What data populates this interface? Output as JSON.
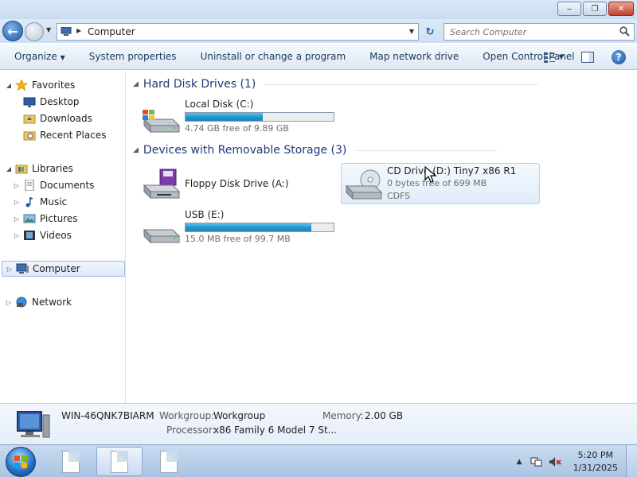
{
  "window": {
    "minimize": "‒",
    "maximize": "❐",
    "close": "✕"
  },
  "address": {
    "path": "Computer",
    "search_placeholder": "Search Computer"
  },
  "toolbar": {
    "organize": "Organize",
    "system_properties": "System properties",
    "uninstall": "Uninstall or change a program",
    "map_network_drive": "Map network drive",
    "open_control_panel": "Open Control Panel",
    "help": "?"
  },
  "nav": {
    "favorites": "Favorites",
    "desktop": "Desktop",
    "downloads": "Downloads",
    "recent_places": "Recent Places",
    "libraries": "Libraries",
    "documents": "Documents",
    "music": "Music",
    "pictures": "Pictures",
    "videos": "Videos",
    "computer": "Computer",
    "network": "Network"
  },
  "groups": {
    "hdd_title": "Hard Disk Drives (1)",
    "removable_title": "Devices with Removable Storage (3)"
  },
  "drives": {
    "c": {
      "name": "Local Disk (C:)",
      "free": "4.74 GB free of 9.89 GB",
      "used_fraction": 0.52
    },
    "a": {
      "name": "Floppy Disk Drive (A:)"
    },
    "d": {
      "name": "CD Drive (D:) Tiny7 x86 R1",
      "free": "0 bytes free of 699 MB",
      "fs": "CDFS"
    },
    "e": {
      "name": "USB (E:)",
      "free": "15.0 MB free of 99.7 MB",
      "used_fraction": 0.85
    }
  },
  "details": {
    "pc_name": "WIN-46QNK7BIARM",
    "workgroup_label": "Workgroup:",
    "workgroup_value": "Workgroup",
    "memory_label": "Memory:",
    "memory_value": "2.00 GB",
    "processor_label": "Processor:",
    "processor_value": "x86 Family 6 Model 7 St..."
  },
  "taskbar": {
    "time": "5:20 PM",
    "date": "1/31/2025"
  }
}
